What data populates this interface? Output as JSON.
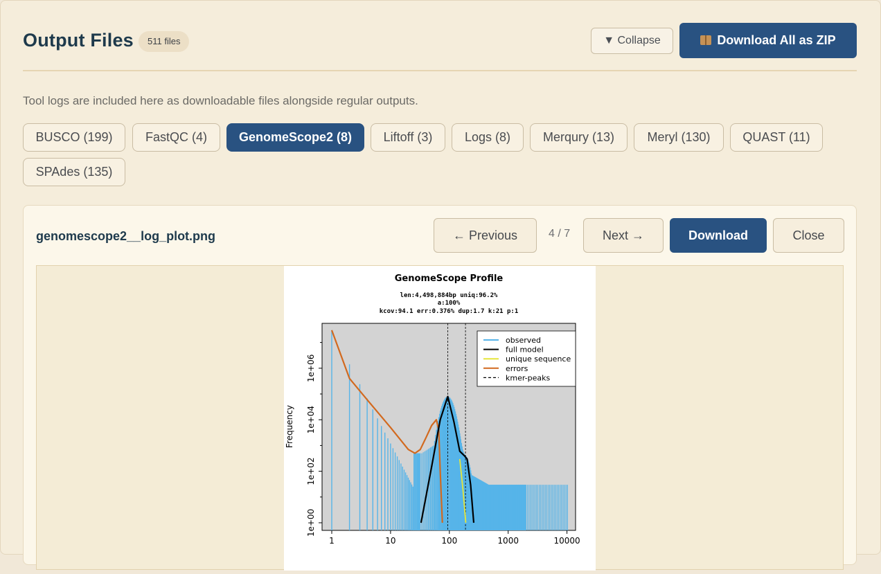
{
  "header": {
    "title": "Output Files",
    "file_count": "511 files",
    "collapse_label": "▼ Collapse",
    "zip_label": "Download All as ZIP",
    "zip_icon": "package-icon"
  },
  "note": "Tool logs are included here as downloadable files alongside regular outputs.",
  "tabs": [
    {
      "label": "BUSCO (199)",
      "active": false
    },
    {
      "label": "FastQC (4)",
      "active": false
    },
    {
      "label": "GenomeScope2 (8)",
      "active": true
    },
    {
      "label": "Liftoff (3)",
      "active": false
    },
    {
      "label": "Logs (8)",
      "active": false
    },
    {
      "label": "Merqury (13)",
      "active": false
    },
    {
      "label": "Meryl (130)",
      "active": false
    },
    {
      "label": "QUAST (11)",
      "active": false
    },
    {
      "label": "SPAdes (135)",
      "active": false
    }
  ],
  "viewer": {
    "filename": "genomescope2__log_plot.png",
    "prev_label": "← Previous",
    "pager": "4 / 7",
    "next_label": "Next →",
    "download_label": "Download",
    "close_label": "Close"
  },
  "chart_data": {
    "type": "line",
    "title": "GenomeScope Profile",
    "subtitle_lines": [
      "len:4,498,884bp uniq:96.2%",
      "a:100%",
      "kcov:94.1 err:0.376%  dup:1.7  k:21 p:1"
    ],
    "xlabel": "",
    "ylabel": "Frequency",
    "x_scale": "log",
    "y_scale": "log",
    "x_ticks": [
      "1",
      "10",
      "100",
      "1000",
      "10000"
    ],
    "y_ticks": [
      "1e+00",
      "1e+02",
      "1e+04",
      "1e+06"
    ],
    "legend": [
      "observed",
      "full model",
      "unique sequence",
      "errors",
      "kmer-peaks"
    ],
    "legend_position": "top-right",
    "kmer_peaks": [
      94,
      188
    ],
    "colors": {
      "observed": "#56b4e9",
      "full_model": "#000000",
      "unique": "#e6e63a",
      "errors": "#d2691e",
      "background": "#d3d3d3"
    },
    "series": [
      {
        "name": "errors",
        "x": [
          1,
          2,
          4,
          10,
          20,
          26,
          32,
          40,
          50,
          60,
          66,
          70,
          76
        ],
        "y": [
          30000000,
          400000,
          60000,
          5000,
          700,
          500,
          700,
          2000,
          6000,
          10000,
          4000,
          100,
          1
        ]
      },
      {
        "name": "full model",
        "x": [
          33,
          50,
          70,
          94,
          120,
          150,
          180,
          200,
          230,
          260
        ],
        "y": [
          1,
          150,
          10000,
          80000,
          8000,
          600,
          400,
          300,
          30,
          1
        ]
      },
      {
        "name": "unique sequence",
        "x": [
          150,
          170,
          190
        ],
        "y": [
          300,
          20,
          1
        ]
      }
    ]
  }
}
